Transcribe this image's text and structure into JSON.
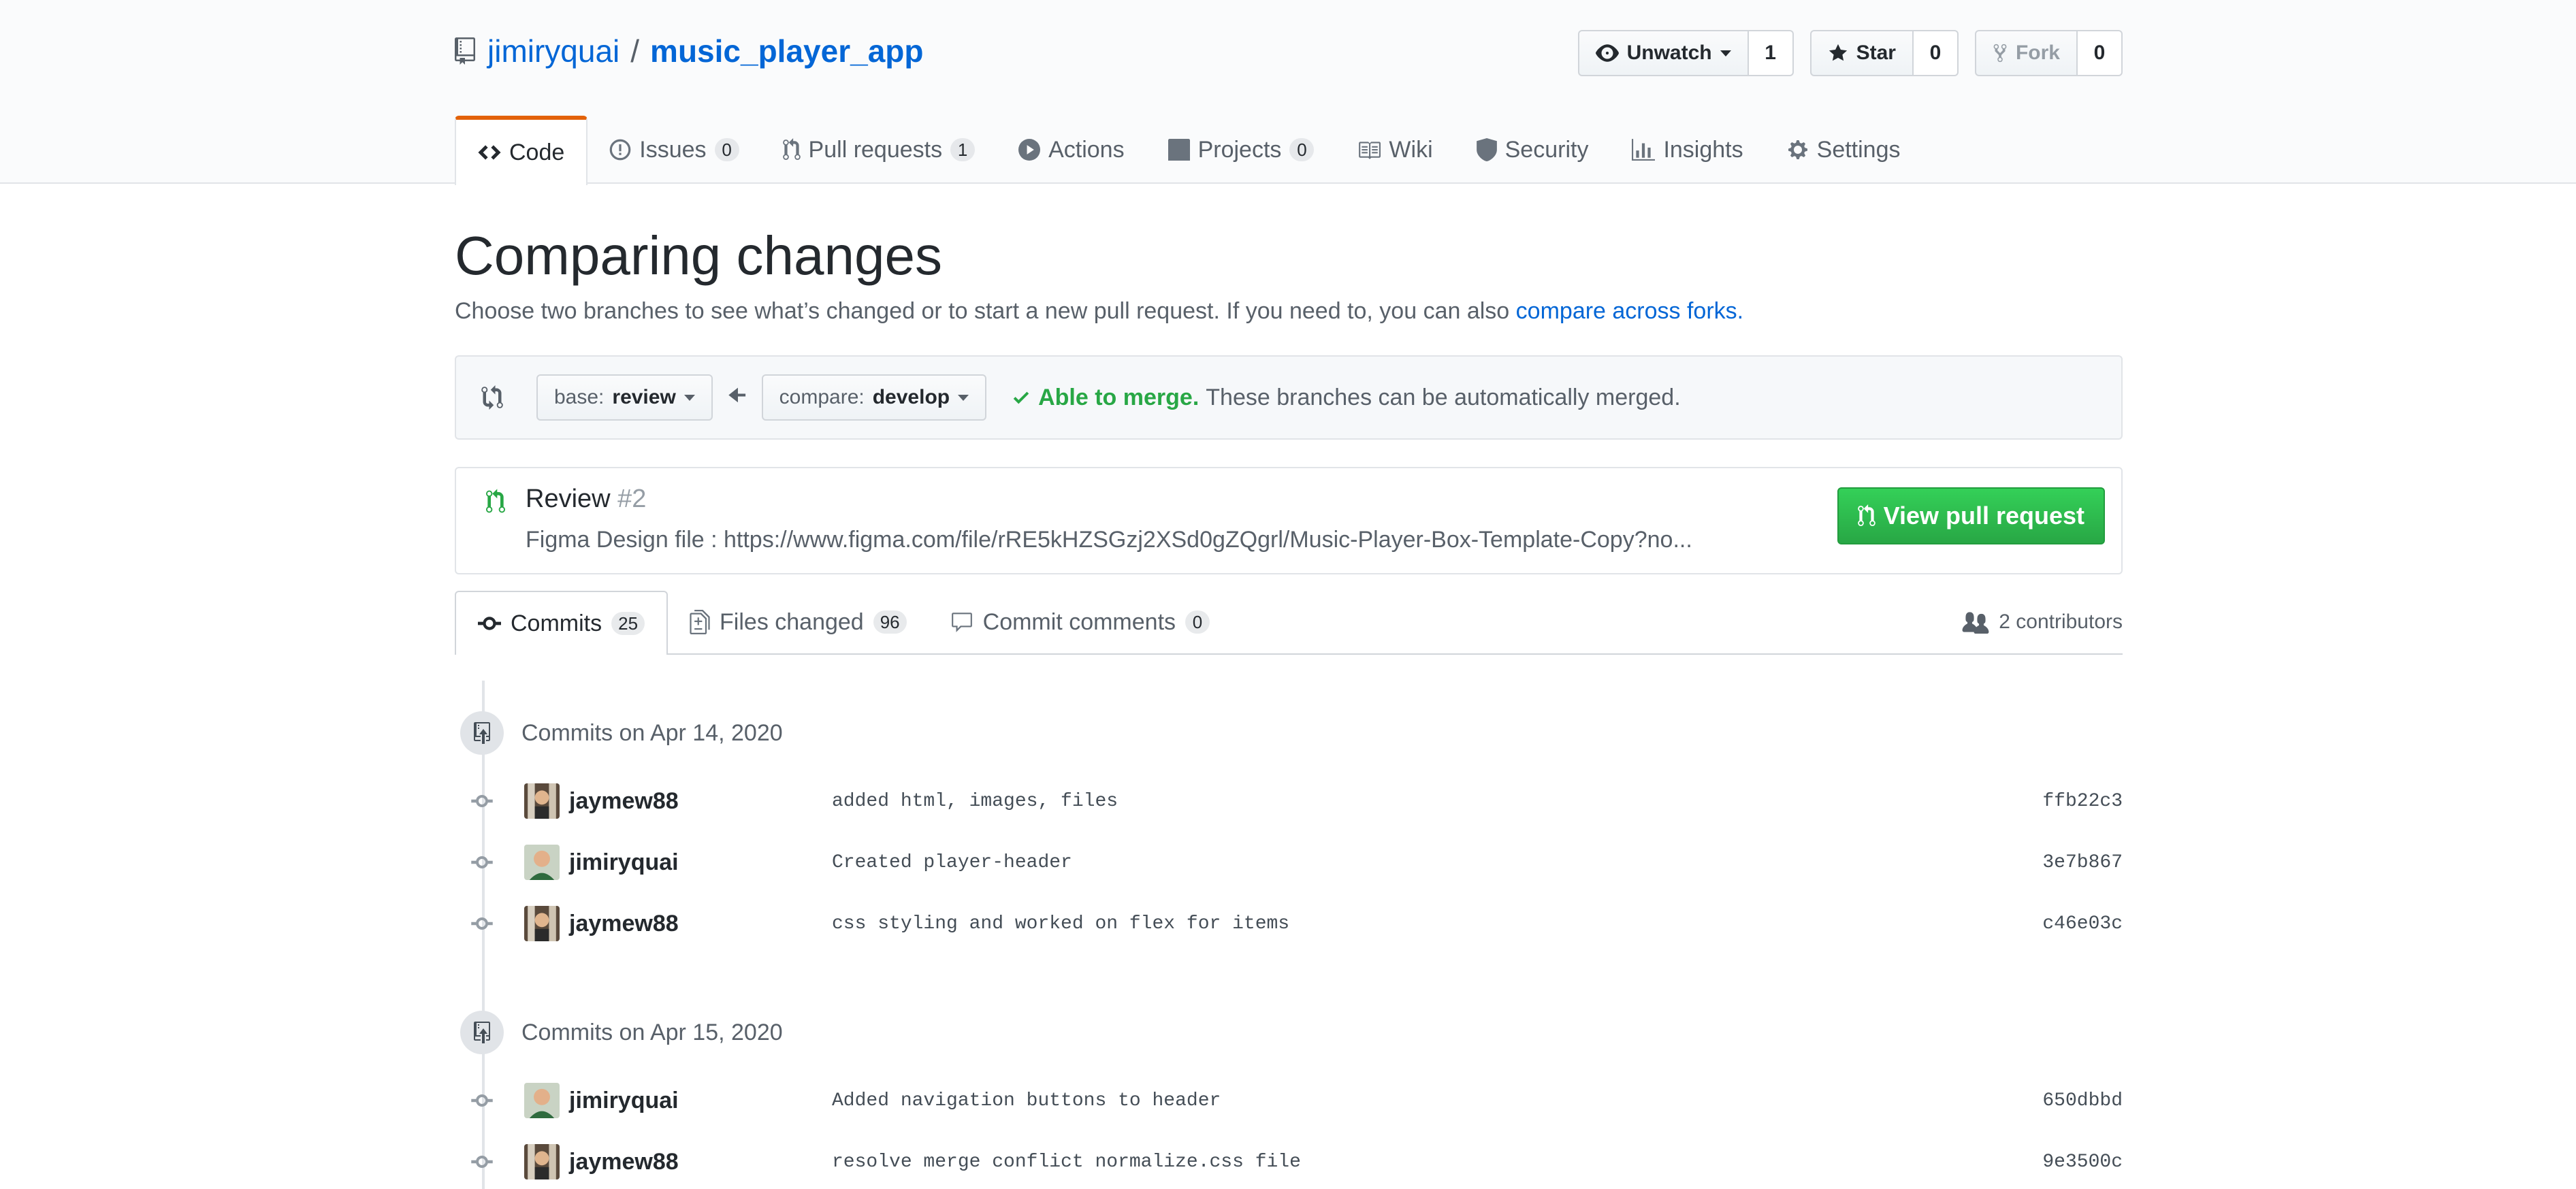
{
  "repo": {
    "owner": "jimiryquai",
    "separator": "/",
    "name": "music_player_app"
  },
  "repo_actions": {
    "watch": {
      "label": "Unwatch",
      "count": "1"
    },
    "star": {
      "label": "Star",
      "count": "0"
    },
    "fork": {
      "label": "Fork",
      "count": "0"
    }
  },
  "nav_tabs": [
    {
      "label": "Code"
    },
    {
      "label": "Issues",
      "count": "0"
    },
    {
      "label": "Pull requests",
      "count": "1"
    },
    {
      "label": "Actions"
    },
    {
      "label": "Projects",
      "count": "0"
    },
    {
      "label": "Wiki"
    },
    {
      "label": "Security"
    },
    {
      "label": "Insights"
    },
    {
      "label": "Settings"
    }
  ],
  "page": {
    "title": "Comparing changes",
    "subtitle": "Choose two branches to see what’s changed or to start a new pull request. If you need to, you can also",
    "subtitle_link": "compare across forks."
  },
  "range": {
    "base_prefix": "base:",
    "base_branch": "review",
    "compare_prefix": "compare:",
    "compare_branch": "develop",
    "merge_ok": "Able to merge.",
    "merge_text": "These branches can be automatically merged."
  },
  "pull_request": {
    "title": "Review",
    "number": "#2",
    "description": "Figma Design file : https://www.figma.com/file/rRE5kHZSGzj2XSd0gZQgrl/Music-Player-Box-Template-Copy?no...",
    "button_label": "View pull request"
  },
  "compare_tabs": [
    {
      "label": "Commits",
      "count": "25"
    },
    {
      "label": "Files changed",
      "count": "96"
    },
    {
      "label": "Commit comments",
      "count": "0"
    }
  ],
  "contributors": "2 contributors",
  "commit_groups": [
    {
      "title": "Commits on Apr 14, 2020",
      "commits": [
        {
          "author": "jaymew88",
          "message": "added html, images, files",
          "sha": "ffb22c3"
        },
        {
          "author": "jimiryquai",
          "message": "Created player-header",
          "sha": "3e7b867"
        },
        {
          "author": "jaymew88",
          "message": "css styling and worked on flex for items",
          "sha": "c46e03c"
        }
      ]
    },
    {
      "title": "Commits on Apr 15, 2020",
      "commits": [
        {
          "author": "jimiryquai",
          "message": "Added navigation buttons to header",
          "sha": "650dbbd"
        },
        {
          "author": "jaymew88",
          "message": "resolve merge conflict normalize.css file",
          "sha": "9e3500c"
        }
      ]
    }
  ],
  "colors": {
    "link": "#0366d6",
    "accent_tab": "#e36209",
    "success": "#28a745"
  }
}
